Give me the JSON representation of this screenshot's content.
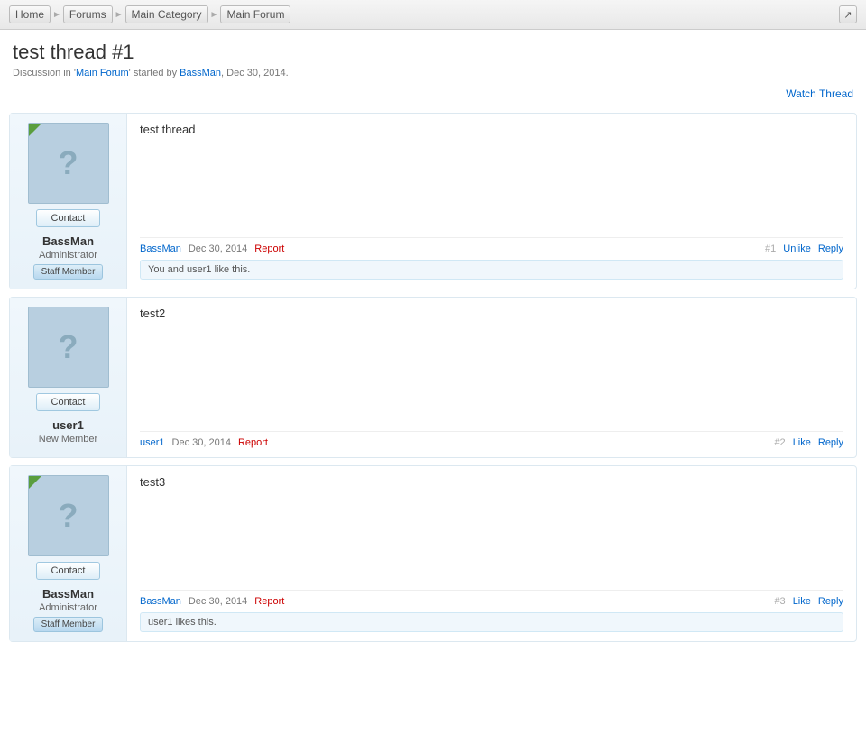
{
  "breadcrumb": {
    "items": [
      "Home",
      "Forums",
      "Main Category",
      "Main Forum"
    ],
    "external_icon": "↗"
  },
  "page": {
    "title": "test thread #1",
    "subtitle_prefix": "Discussion in '",
    "forum_name": "Main Forum",
    "subtitle_suffix": "' started by ",
    "author": "BassMan",
    "date": "Dec 30, 2014.",
    "watch_label": "Watch Thread"
  },
  "posts": [
    {
      "id": "1",
      "num": "#1",
      "content": "test thread",
      "author": "BassMan",
      "date": "Dec 30, 2014",
      "report_label": "Report",
      "unlike_label": "Unlike",
      "reply_label": "Reply",
      "has_badge": true,
      "role": "Administrator",
      "staff": true,
      "staff_label": "Staff Member",
      "contact_label": "Contact",
      "likes_text": "You and user1 like this."
    },
    {
      "id": "2",
      "num": "#2",
      "content": "test2",
      "author": "user1",
      "date": "Dec 30, 2014",
      "report_label": "Report",
      "like_label": "Like",
      "reply_label": "Reply",
      "has_badge": false,
      "role": "New Member",
      "staff": false,
      "staff_label": "",
      "contact_label": "Contact",
      "likes_text": ""
    },
    {
      "id": "3",
      "num": "#3",
      "content": "test3",
      "author": "BassMan",
      "date": "Dec 30, 2014",
      "report_label": "Report",
      "like_label": "Like",
      "reply_label": "Reply",
      "has_badge": true,
      "role": "Administrator",
      "staff": true,
      "staff_label": "Staff Member",
      "contact_label": "Contact",
      "likes_text": "user1 likes this."
    }
  ]
}
